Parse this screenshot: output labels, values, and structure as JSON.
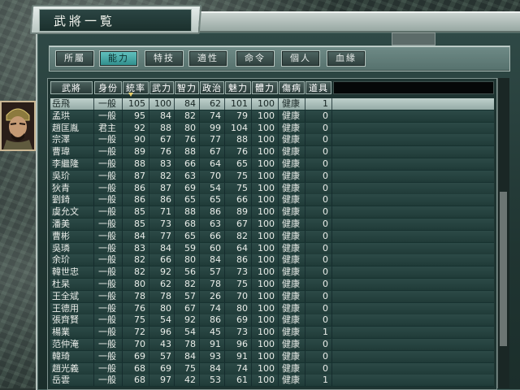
{
  "window": {
    "title": "武將一覧"
  },
  "tabs": [
    {
      "label": "所屬",
      "active": false
    },
    {
      "label": "能力",
      "active": true
    },
    {
      "label": "特技",
      "active": false
    },
    {
      "label": "適性",
      "active": false
    },
    {
      "label": "命令",
      "active": false
    },
    {
      "label": "個人",
      "active": false
    },
    {
      "label": "血緣",
      "active": false
    }
  ],
  "columns": [
    "武將",
    "身份",
    "統率",
    "武力",
    "智力",
    "政治",
    "魅力",
    "體力",
    "傷病",
    "道具"
  ],
  "sorted_column": "統率",
  "rows": [
    [
      "岳飛",
      "一般",
      "105",
      "100",
      "84",
      "62",
      "101",
      "100",
      "健康",
      "1"
    ],
    [
      "孟珙",
      "一般",
      "95",
      "84",
      "82",
      "74",
      "79",
      "100",
      "健康",
      "0"
    ],
    [
      "趙匡胤",
      "君主",
      "92",
      "88",
      "80",
      "99",
      "104",
      "100",
      "健康",
      "0"
    ],
    [
      "宗澤",
      "一般",
      "90",
      "67",
      "76",
      "77",
      "88",
      "100",
      "健康",
      "0"
    ],
    [
      "曹瑋",
      "一般",
      "89",
      "76",
      "88",
      "67",
      "76",
      "100",
      "健康",
      "0"
    ],
    [
      "李繼隆",
      "一般",
      "88",
      "83",
      "66",
      "64",
      "65",
      "100",
      "健康",
      "0"
    ],
    [
      "吳玠",
      "一般",
      "87",
      "82",
      "63",
      "70",
      "75",
      "100",
      "健康",
      "0"
    ],
    [
      "狄青",
      "一般",
      "86",
      "87",
      "69",
      "54",
      "75",
      "100",
      "健康",
      "0"
    ],
    [
      "劉錡",
      "一般",
      "86",
      "86",
      "65",
      "65",
      "66",
      "100",
      "健康",
      "0"
    ],
    [
      "虞允文",
      "一般",
      "85",
      "71",
      "88",
      "86",
      "89",
      "100",
      "健康",
      "0"
    ],
    [
      "潘美",
      "一般",
      "85",
      "73",
      "68",
      "63",
      "67",
      "100",
      "健康",
      "0"
    ],
    [
      "曹彬",
      "一般",
      "84",
      "77",
      "65",
      "66",
      "82",
      "100",
      "健康",
      "0"
    ],
    [
      "吳璘",
      "一般",
      "83",
      "84",
      "59",
      "60",
      "64",
      "100",
      "健康",
      "0"
    ],
    [
      "余玠",
      "一般",
      "82",
      "66",
      "80",
      "84",
      "86",
      "100",
      "健康",
      "0"
    ],
    [
      "韓世忠",
      "一般",
      "82",
      "92",
      "56",
      "57",
      "73",
      "100",
      "健康",
      "0"
    ],
    [
      "杜杲",
      "一般",
      "80",
      "62",
      "82",
      "78",
      "75",
      "100",
      "健康",
      "0"
    ],
    [
      "王全斌",
      "一般",
      "78",
      "78",
      "57",
      "26",
      "70",
      "100",
      "健康",
      "0"
    ],
    [
      "王德用",
      "一般",
      "76",
      "80",
      "67",
      "74",
      "80",
      "100",
      "健康",
      "0"
    ],
    [
      "張齊賢",
      "一般",
      "75",
      "54",
      "92",
      "86",
      "69",
      "100",
      "健康",
      "0"
    ],
    [
      "楊業",
      "一般",
      "72",
      "96",
      "54",
      "45",
      "73",
      "100",
      "健康",
      "1"
    ],
    [
      "范仲淹",
      "一般",
      "70",
      "43",
      "78",
      "91",
      "96",
      "100",
      "健康",
      "0"
    ],
    [
      "韓琦",
      "一般",
      "69",
      "57",
      "84",
      "93",
      "91",
      "100",
      "健康",
      "0"
    ],
    [
      "趙光義",
      "一般",
      "68",
      "69",
      "75",
      "84",
      "74",
      "100",
      "健康",
      "0"
    ],
    [
      "岳雲",
      "一般",
      "68",
      "97",
      "42",
      "53",
      "61",
      "100",
      "健康",
      "1"
    ]
  ],
  "selected_row_index": 0,
  "portrait": {
    "icon": "general-portrait"
  }
}
